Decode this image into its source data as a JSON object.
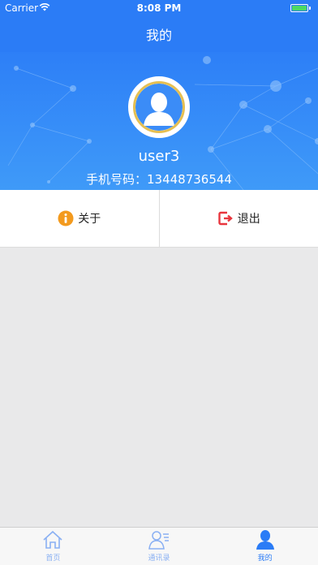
{
  "status_bar": {
    "carrier": "Carrier",
    "time": "8:08 PM"
  },
  "nav": {
    "title": "我的"
  },
  "profile": {
    "username": "user3",
    "phone_text": "手机号码：13448736544"
  },
  "actions": [
    {
      "label": "关于",
      "icon": "info-icon"
    },
    {
      "label": "退出",
      "icon": "logout-icon"
    }
  ],
  "tabs": [
    {
      "label": "首页",
      "icon": "home-icon",
      "active": false
    },
    {
      "label": "通讯录",
      "icon": "contacts-icon",
      "active": false
    },
    {
      "label": "我的",
      "icon": "user-icon",
      "active": true
    }
  ],
  "colors": {
    "primary": "#2b7cf6",
    "avatar_ring": "#e5bf52",
    "info_icon": "#f39a1e",
    "logout_icon": "#e8363e"
  }
}
